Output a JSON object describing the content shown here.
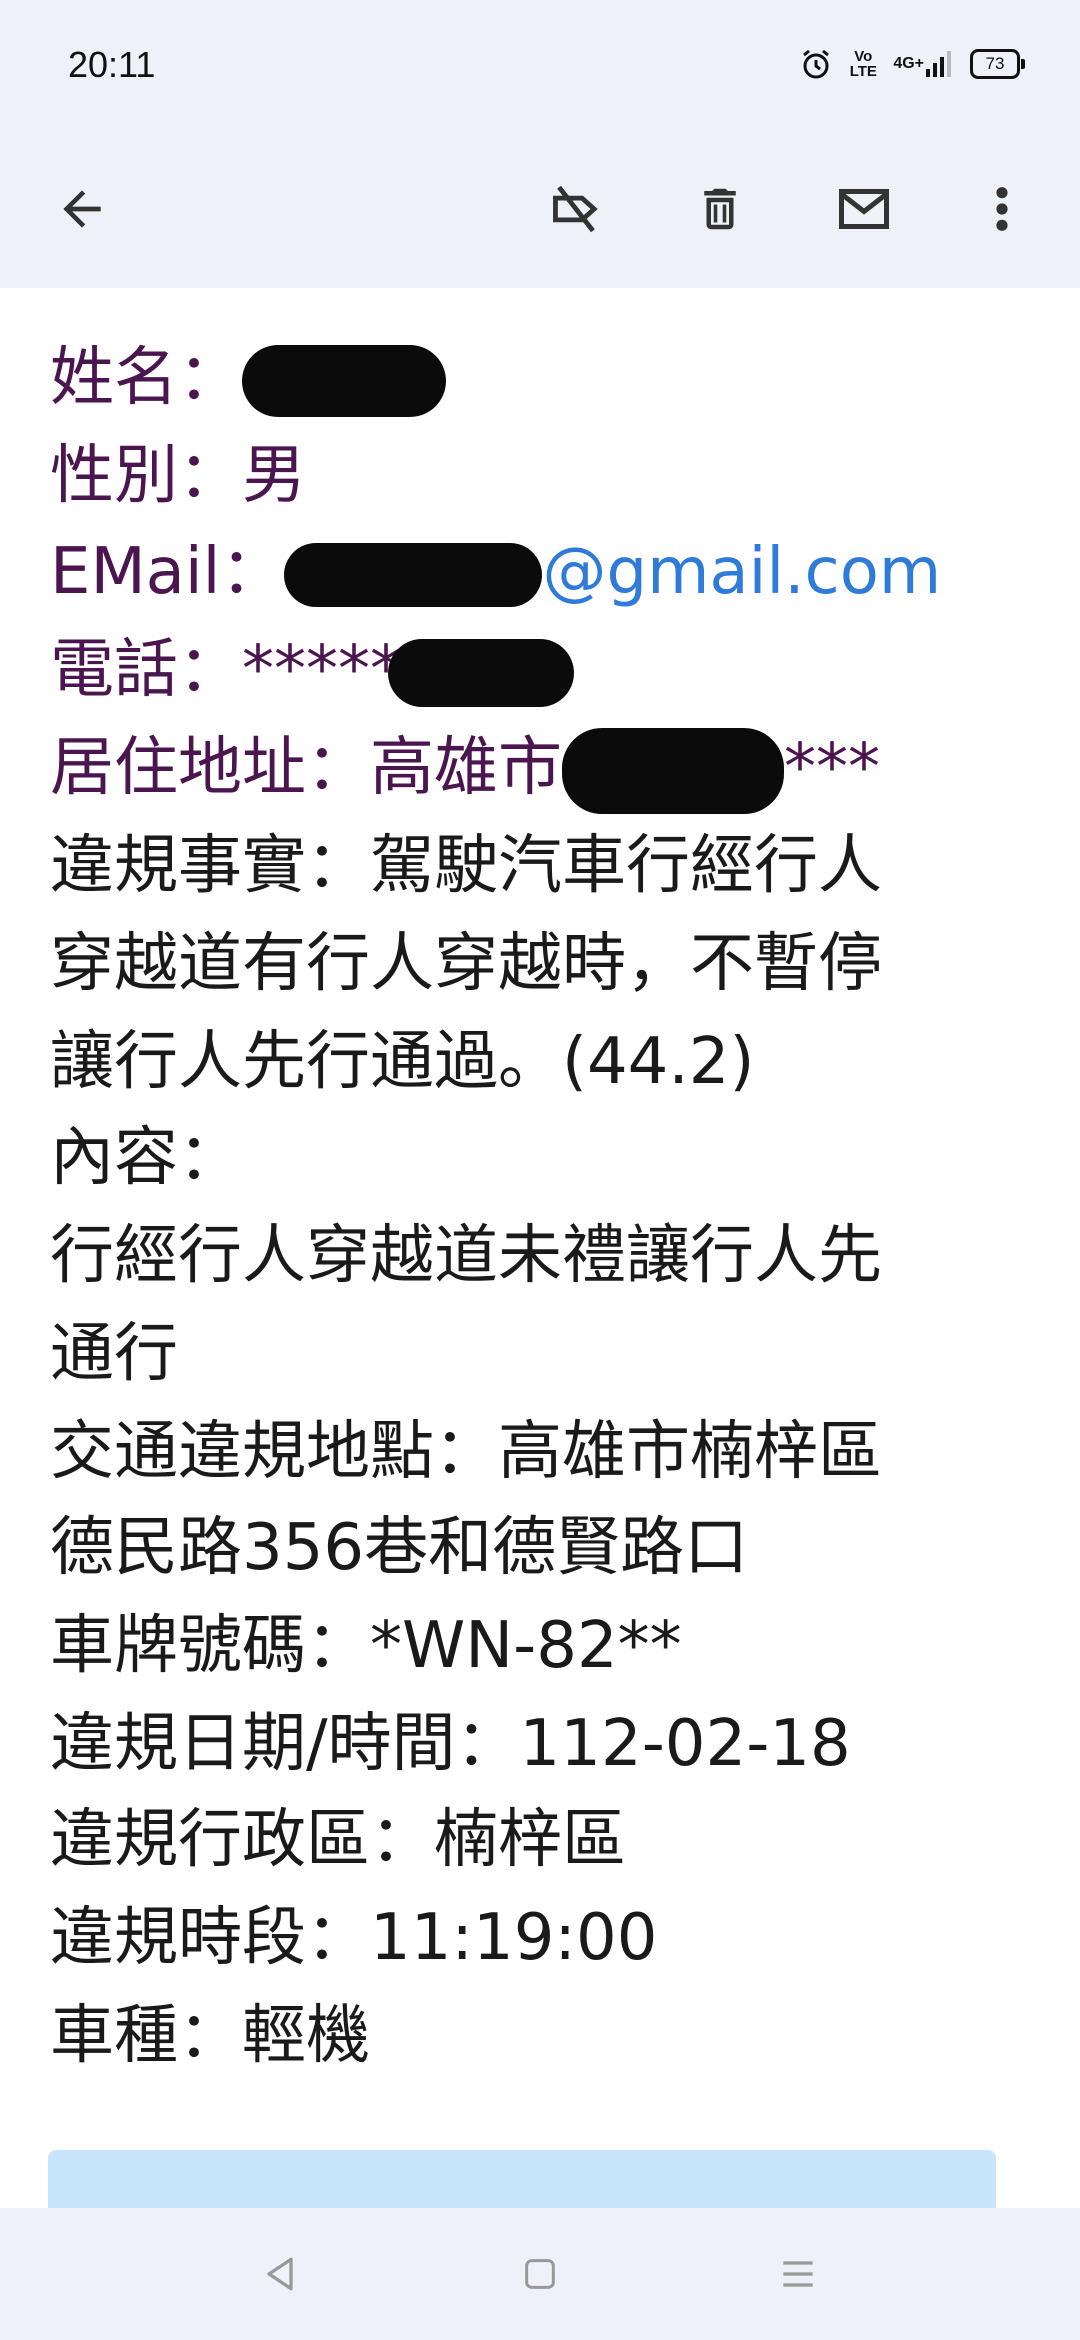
{
  "status_bar": {
    "time": "20:11",
    "volte": "Vo LTE",
    "network": "4G+",
    "battery": "73",
    "icons": [
      "alarm-icon",
      "volte-icon",
      "signal-icon",
      "battery-icon"
    ]
  },
  "toolbar": {
    "icons": [
      "back-arrow-icon",
      "label-off-icon",
      "delete-icon",
      "mail-icon",
      "more-vert-icon"
    ]
  },
  "email": {
    "name_label": "姓名：",
    "gender_label": "性別：",
    "gender_value": "男",
    "email_label": "EMail：",
    "email_visible_part": "@gmail.com",
    "phone_label": "電話：",
    "phone_visible_part": "*****",
    "address_label": "居住地址：",
    "address_visible_part": "高雄市",
    "address_trailing": "***",
    "violation_fact_l1": "違規事實：駕駛汽車行經行人",
    "violation_fact_l2": "穿越道有行人穿越時，不暫停",
    "violation_fact_l3": "讓行人先行通過。(44.2)",
    "content_label": "內容：",
    "content_l1": "行經行人穿越道未禮讓行人先",
    "content_l2": "通行",
    "location_l1": "交通違規地點：高雄市楠梓區",
    "location_l2": "德民路356巷和德賢路口",
    "plate": "車牌號碼：*WN-82**",
    "date": "違規日期/時間：112-02-18",
    "district": "違規行政區：楠梓區",
    "time_period": "違規時段：11:19:00",
    "vehicle_type": "車種：輕機"
  },
  "colors": {
    "header_bg": "#eef2f8",
    "label_purple": "#4b154f",
    "link_blue": "#2f7bd9",
    "card_blue": "#c8e6fb"
  },
  "nav_bar": {
    "icons": [
      "back-triangle-icon",
      "home-square-icon",
      "recents-menu-icon"
    ]
  }
}
